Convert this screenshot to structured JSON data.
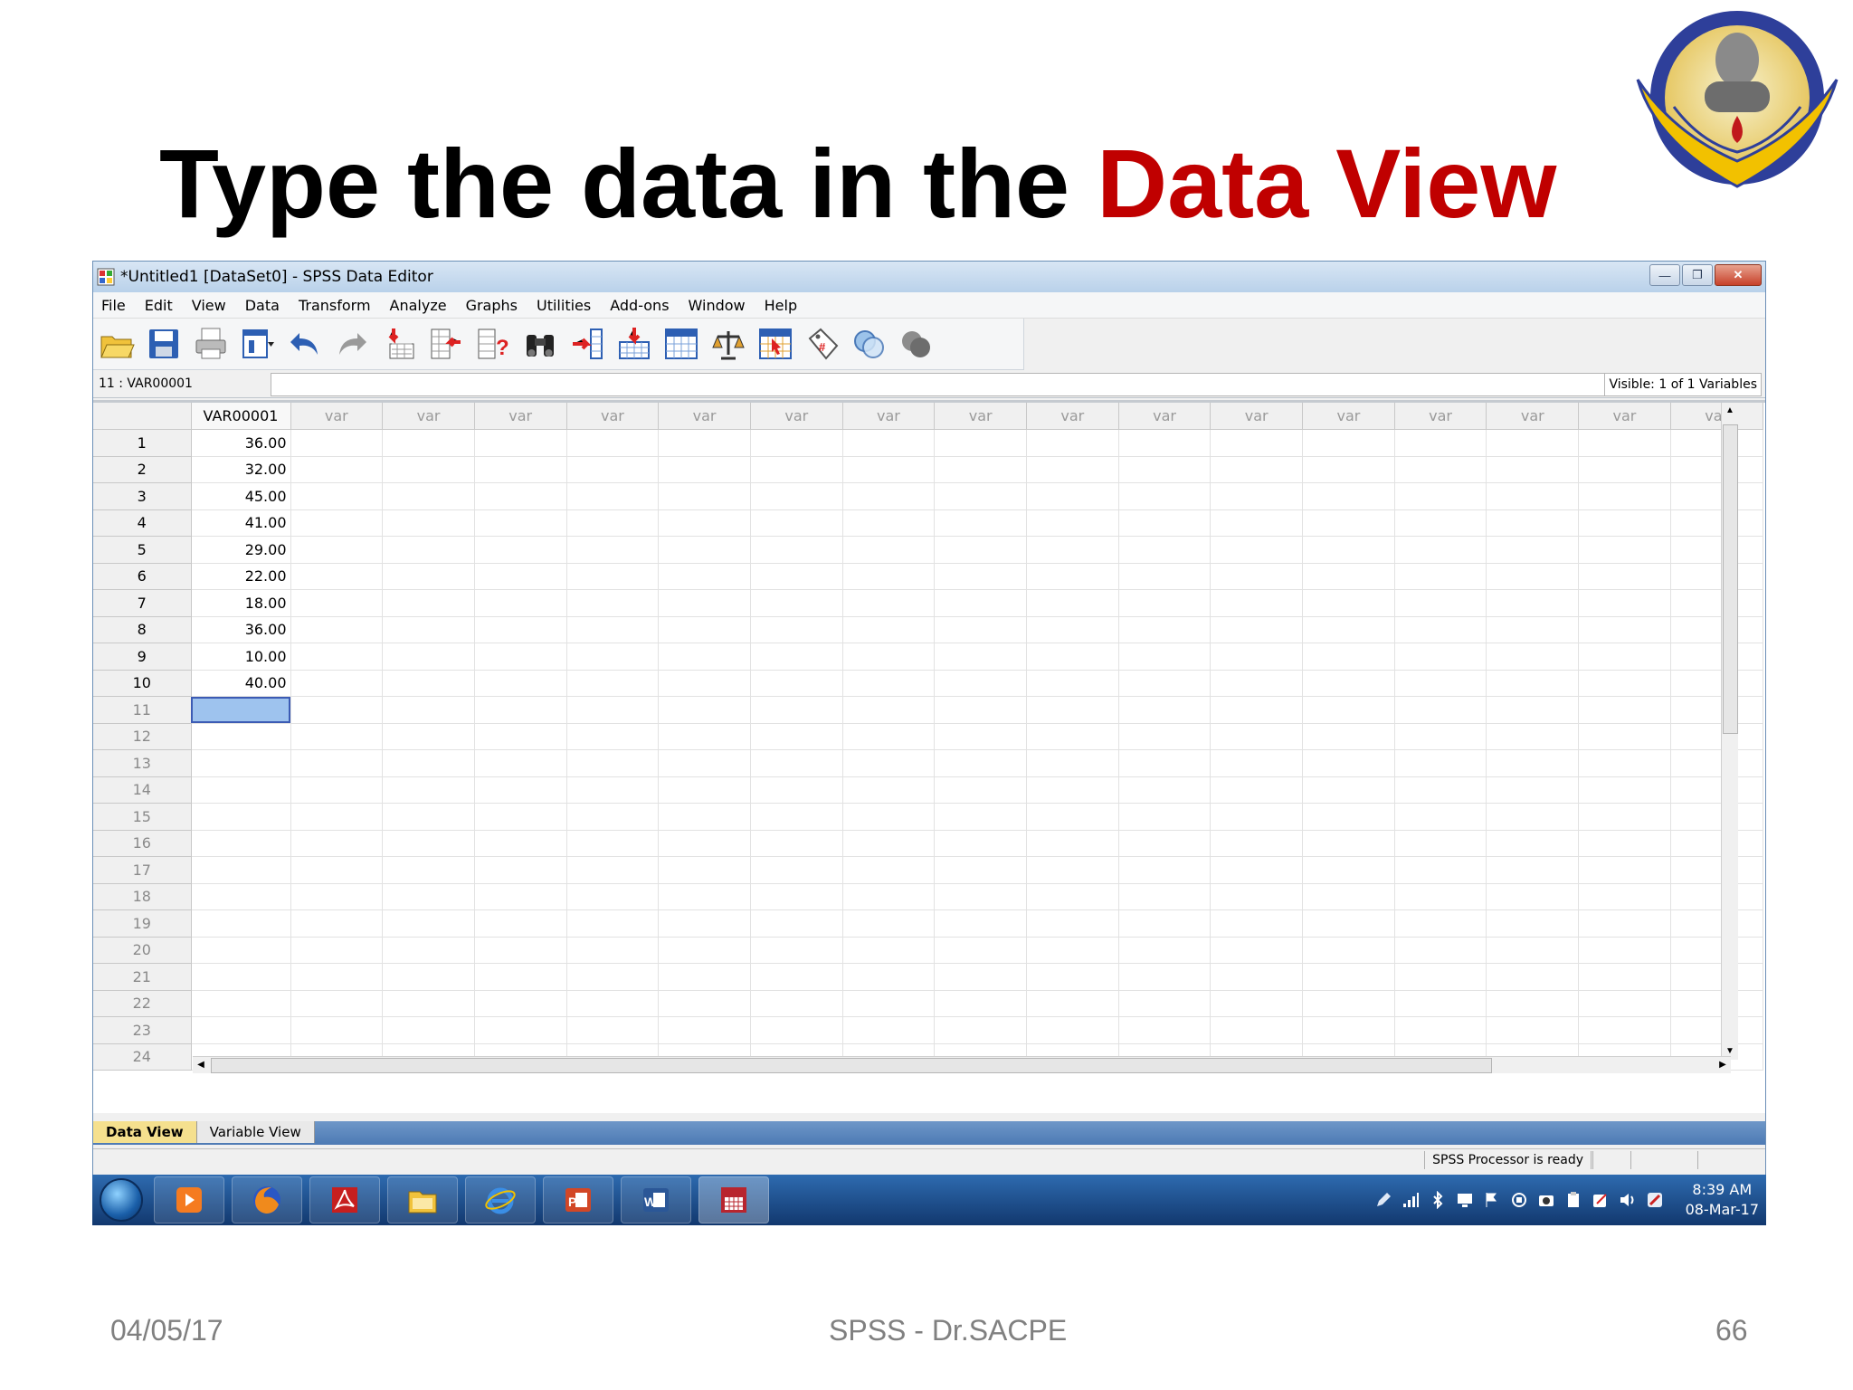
{
  "slide": {
    "title_part1": "Type the data in the ",
    "title_part2": "Data View",
    "footer_date": "04/05/17",
    "footer_center": "SPSS - Dr.SACPE",
    "footer_page": "66"
  },
  "window": {
    "title": "*Untitled1 [DataSet0] - SPSS Data Editor",
    "minimize": "—",
    "restore": "❐",
    "close": "✕"
  },
  "menu": [
    "File",
    "Edit",
    "View",
    "Data",
    "Transform",
    "Analyze",
    "Graphs",
    "Utilities",
    "Add-ons",
    "Window",
    "Help"
  ],
  "cellbar": {
    "ref": "11 : VAR00001",
    "value": "",
    "visible": "Visible: 1 of 1 Variables"
  },
  "grid": {
    "columns": [
      "VAR00001",
      "var",
      "var",
      "var",
      "var",
      "var",
      "var",
      "var",
      "var",
      "var",
      "var",
      "var",
      "var",
      "var",
      "var",
      "var",
      "var"
    ],
    "rows": [
      "1",
      "2",
      "3",
      "4",
      "5",
      "6",
      "7",
      "8",
      "9",
      "10",
      "11",
      "12",
      "13",
      "14",
      "15",
      "16",
      "17",
      "18",
      "19",
      "20",
      "21",
      "22",
      "23",
      "24"
    ],
    "values": [
      "36.00",
      "32.00",
      "45.00",
      "41.00",
      "29.00",
      "22.00",
      "18.00",
      "36.00",
      "10.00",
      "40.00"
    ],
    "active_row": 11
  },
  "tabs": {
    "data_view": "Data View",
    "variable_view": "Variable View"
  },
  "status": "SPSS  Processor is ready",
  "clock": {
    "time": "8:39 AM",
    "date": "08-Mar-17"
  },
  "colors": {
    "title_highlight": "#c00000",
    "active_cell": "#9ec3ee",
    "taskbar": "#1f4f8c"
  }
}
